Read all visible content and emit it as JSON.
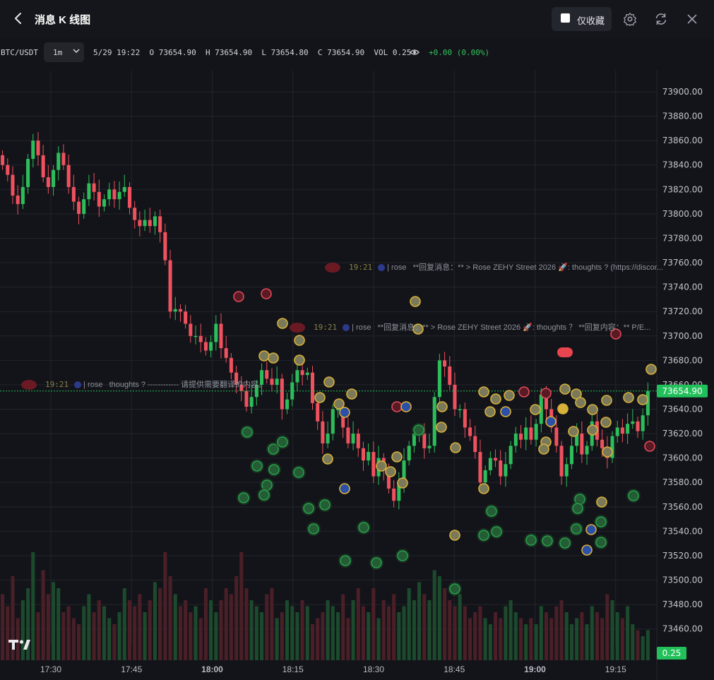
{
  "header": {
    "title": "消息 K 线图",
    "favorites_label": "仅收藏"
  },
  "toolbar": {
    "symbol": "BTC/USDT",
    "interval": "1m",
    "ohlc_text": "5/29 19:22  O 73654.90  H 73654.90  L 73654.80  C 73654.90  VOL 0.25",
    "change": "+0.00 (0.00%)"
  },
  "messages": [
    {
      "time": "19:21",
      "user": "| rose",
      "text": "**回复消息：** > Rose ZEHY Street 2026 🚀: thoughts ? (https://discor..."
    },
    {
      "time": "19:21",
      "user": "| rose",
      "text": "**回复消息：** > Rose ZEHY Street 2026 🚀: thoughts ？ **回复内容：** P/E..."
    },
    {
      "time": "19:21",
      "user": "| rose",
      "text": "thoughts ? ------------ 请提供需要翻译的内容。"
    }
  ],
  "colors": {
    "up": "#2dbd5a",
    "down": "#f0515f",
    "grid": "#22252c",
    "price_tag": "#22c05a",
    "gold_marker": "#d8b13a",
    "green_marker": "#2a9d4a"
  },
  "chart_data": {
    "type": "candlestick",
    "price_axis": {
      "min": 73440,
      "max": 73910,
      "ticks": [
        73900.0,
        73880.0,
        73860.0,
        73840.0,
        73820.0,
        73800.0,
        73780.0,
        73760.0,
        73740.0,
        73720.0,
        73700.0,
        73680.0,
        73660.0,
        73640.0,
        73620.0,
        73600.0,
        73580.0,
        73560.0,
        73540.0,
        73520.0,
        73500.0,
        73480.0,
        73460.0,
        73440.0
      ]
    },
    "time_axis": {
      "start": "17:21",
      "end": "19:22",
      "labels": [
        {
          "label": "17:30",
          "bold": false
        },
        {
          "label": "17:45",
          "bold": false
        },
        {
          "label": "18:00",
          "bold": true
        },
        {
          "label": "18:15",
          "bold": false
        },
        {
          "label": "18:30",
          "bold": false
        },
        {
          "label": "18:45",
          "bold": false
        },
        {
          "label": "19:00",
          "bold": true
        },
        {
          "label": "19:15",
          "bold": false
        }
      ]
    },
    "last_price": "73654.90",
    "last_volume": "0.25",
    "closes": [
      73840,
      73832,
      73815,
      73808,
      73822,
      73845,
      73860,
      73848,
      73830,
      73822,
      73836,
      73850,
      73840,
      73822,
      73810,
      73800,
      73812,
      73825,
      73818,
      73806,
      73812,
      73820,
      73812,
      73818,
      73822,
      73805,
      73795,
      73790,
      73795,
      73790,
      73798,
      73785,
      73762,
      73720,
      73722,
      73720,
      73710,
      73700,
      73700,
      73695,
      73688,
      73695,
      73710,
      73690,
      73682,
      73670,
      73660,
      73655,
      73642,
      73650,
      73660,
      73672,
      73665,
      73660,
      73665,
      73640,
      73648,
      73662,
      73672,
      73668,
      73670,
      73645,
      73630,
      73612,
      73620,
      73640,
      73640,
      73625,
      73612,
      73620,
      73608,
      73598,
      73605,
      73585,
      73600,
      73590,
      73575,
      73565,
      73580,
      73598,
      73610,
      73620,
      73620,
      73608,
      73610,
      73650,
      73680,
      73675,
      73660,
      73640,
      73640,
      73625,
      73618,
      73605,
      73580,
      73590,
      73600,
      73598,
      73585,
      73595,
      73610,
      73620,
      73615,
      73625,
      73615,
      73628,
      73652,
      73640,
      73625,
      73610,
      73585,
      73595,
      73610,
      73620,
      73603,
      73610,
      73630,
      73615,
      73608,
      73600,
      73618,
      73625,
      73620,
      73628,
      73630,
      73622,
      73635,
      73654.9
    ],
    "volumes": [
      0.55,
      0.45,
      0.7,
      0.35,
      0.5,
      0.6,
      0.9,
      0.4,
      0.75,
      0.55,
      0.65,
      0.6,
      0.4,
      0.45,
      0.35,
      0.3,
      0.45,
      0.55,
      0.4,
      0.5,
      0.45,
      0.35,
      0.3,
      0.4,
      0.6,
      0.5,
      0.45,
      0.55,
      0.4,
      0.5,
      0.65,
      0.6,
      0.9,
      0.7,
      0.55,
      0.45,
      0.5,
      0.4,
      0.45,
      0.35,
      0.6,
      0.5,
      0.4,
      0.5,
      0.6,
      0.55,
      0.7,
      0.9,
      0.6,
      0.5,
      0.45,
      0.4,
      0.55,
      0.6,
      0.35,
      0.4,
      0.5,
      0.45,
      0.4,
      0.5,
      0.45,
      0.3,
      0.35,
      0.4,
      0.5,
      0.45,
      0.4,
      0.55,
      0.35,
      0.5,
      0.6,
      0.45,
      0.4,
      0.6,
      0.35,
      0.5,
      0.45,
      0.55,
      0.4,
      0.45,
      0.6,
      0.5,
      0.65,
      0.55,
      0.5,
      0.75,
      0.7,
      0.6,
      0.5,
      0.45,
      0.55,
      0.45,
      0.35,
      0.4,
      0.45,
      0.35,
      0.3,
      0.4,
      0.35,
      0.45,
      0.5,
      0.4,
      0.35,
      0.3,
      0.35,
      0.3,
      0.45,
      0.4,
      0.35,
      0.45,
      0.5,
      0.4,
      0.3,
      0.35,
      0.4,
      0.3,
      0.45,
      0.4,
      0.35,
      0.55,
      0.5,
      0.4,
      0.35,
      0.45,
      0.3,
      0.25,
      0.2,
      0.25
    ]
  }
}
